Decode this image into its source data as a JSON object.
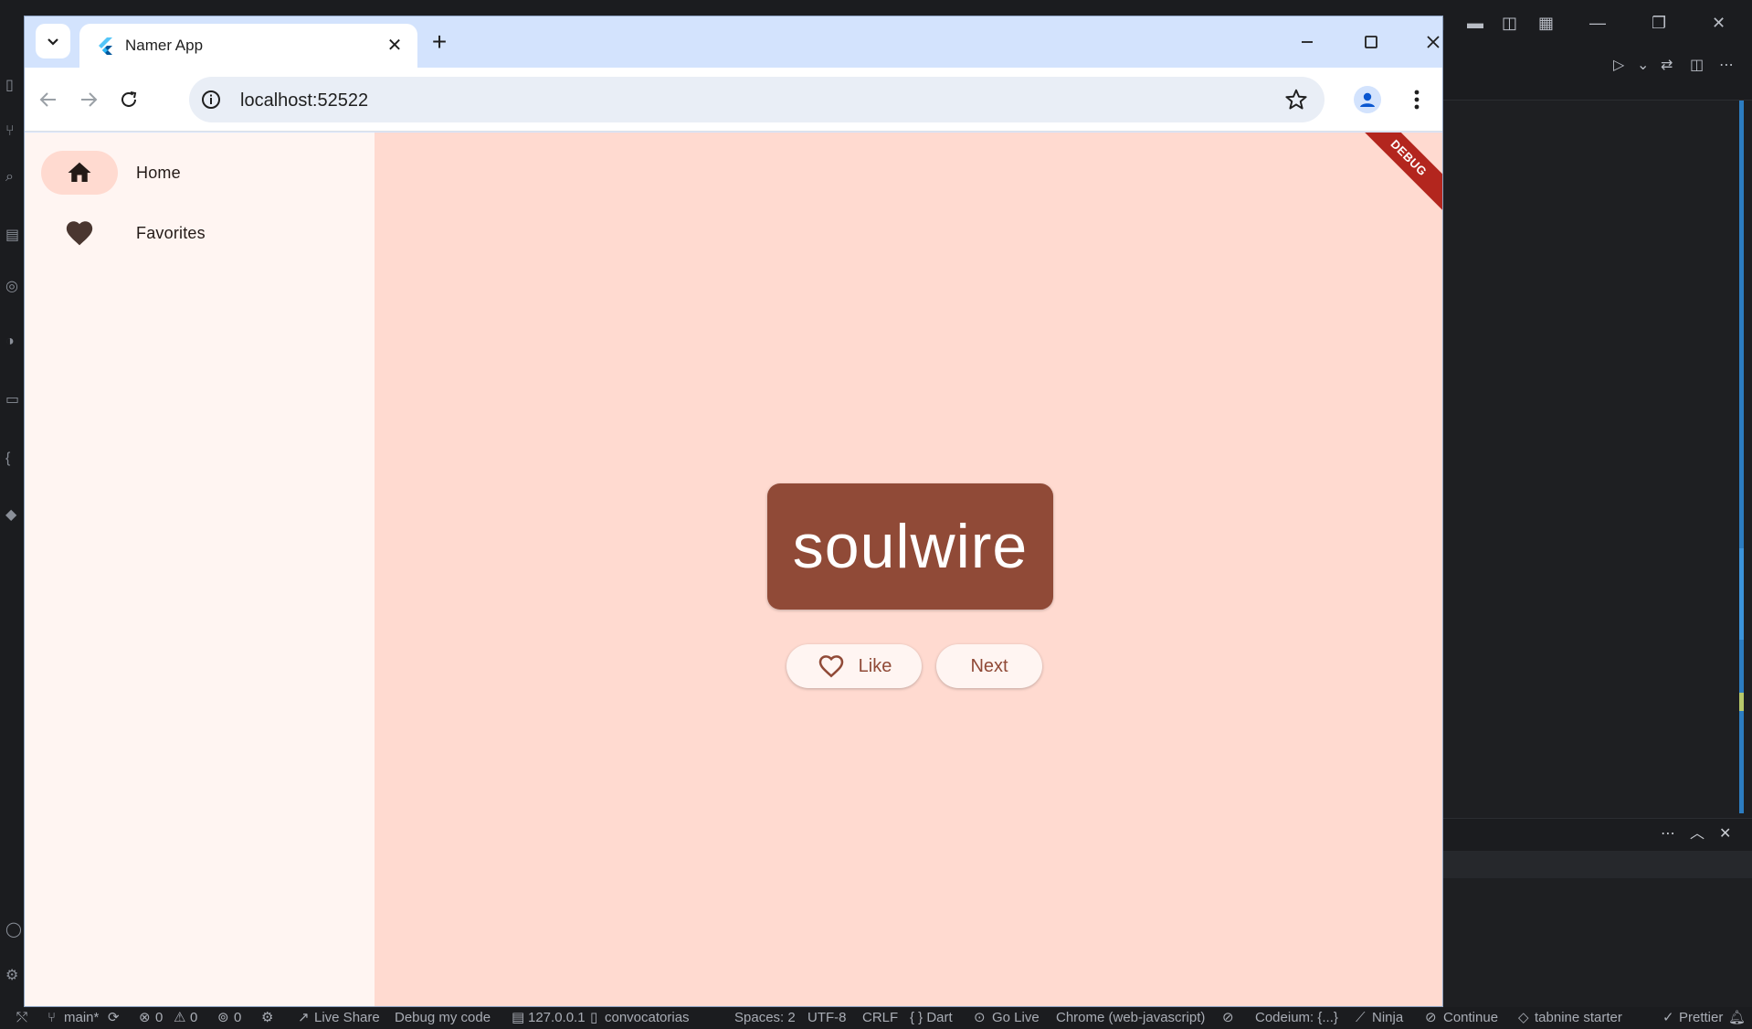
{
  "vscode": {
    "status_bar": {
      "branch": "main*",
      "errors": "0",
      "warnings": "0",
      "ports": "0",
      "live_share": "Live Share",
      "debug": "Debug my code",
      "host": "127.0.0.1",
      "database": "convocatorias",
      "spaces": "Spaces: 2",
      "encoding": "UTF-8",
      "eol": "CRLF",
      "language": "{ } Dart",
      "go_live": "Go Live",
      "device": "Chrome (web-javascript)",
      "codeium": "Codeium: {...}",
      "ninja": "Ninja",
      "continue": "Continue",
      "tabnine": "tabnine starter",
      "prettier": "Prettier"
    }
  },
  "browser": {
    "tab": {
      "title": "Namer App"
    },
    "address": {
      "url": "localhost:52522"
    }
  },
  "app": {
    "nav": [
      {
        "label": "Home",
        "icon": "home-icon",
        "selected": true
      },
      {
        "label": "Favorites",
        "icon": "heart-icon",
        "selected": false
      }
    ],
    "word": "soulwire",
    "like_label": "Like",
    "next_label": "Next",
    "debug_banner": "DEBUG",
    "colors": {
      "primary": "#904a37",
      "background": "#ffdad0",
      "rail": "#fff5f2",
      "debug": "#b3261e"
    }
  }
}
